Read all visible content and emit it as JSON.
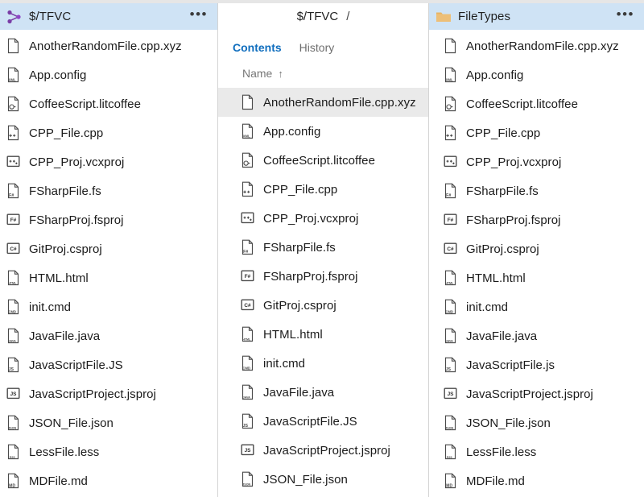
{
  "left_panel": {
    "header": {
      "icon": "tfvc-branch-icon",
      "title": "$/TFVC",
      "overflow_label": "•••"
    },
    "items": [
      {
        "name": "AnotherRandomFile.cpp.xyz",
        "icon": "file-blank-icon",
        "badge": ""
      },
      {
        "name": "App.config",
        "icon": "file-ext-icon",
        "badge": "XML"
      },
      {
        "name": "CoffeeScript.litcoffee",
        "icon": "file-coffee-icon",
        "badge": ""
      },
      {
        "name": "CPP_File.cpp",
        "icon": "file-cpp-icon",
        "badge": ""
      },
      {
        "name": "CPP_Proj.vcxproj",
        "icon": "square-cpp-icon",
        "badge": "++"
      },
      {
        "name": "FSharpFile.fs",
        "icon": "file-fsharp-icon",
        "badge": "F#"
      },
      {
        "name": "FSharpProj.fsproj",
        "icon": "square-badge-icon",
        "badge": "F#"
      },
      {
        "name": "GitProj.csproj",
        "icon": "square-badge-icon",
        "badge": "C#"
      },
      {
        "name": "HTML.html",
        "icon": "file-ext-icon",
        "badge": "HTML"
      },
      {
        "name": "init.cmd",
        "icon": "file-ext-icon",
        "badge": "CMD"
      },
      {
        "name": "JavaFile.java",
        "icon": "file-ext-icon",
        "badge": "JAVA"
      },
      {
        "name": "JavaScriptFile.JS",
        "icon": "file-js-icon",
        "badge": "JS"
      },
      {
        "name": "JavaScriptProject.jsproj",
        "icon": "square-badge-icon",
        "badge": "JS"
      },
      {
        "name": "JSON_File.json",
        "icon": "file-ext-icon",
        "badge": "JSON"
      },
      {
        "name": "LessFile.less",
        "icon": "file-ext-icon",
        "badge": "less"
      },
      {
        "name": "MDFile.md",
        "icon": "file-ext-icon",
        "badge": "MD"
      }
    ]
  },
  "mid_panel": {
    "breadcrumb": {
      "root": "$/TFVC",
      "separator": "/"
    },
    "tabs": [
      {
        "label": "Contents",
        "active": true
      },
      {
        "label": "History",
        "active": false
      }
    ],
    "column_header": {
      "label": "Name",
      "sort_arrow": "↑"
    },
    "items": [
      {
        "name": "AnotherRandomFile.cpp.xyz",
        "icon": "file-blank-icon",
        "badge": "",
        "selected": true
      },
      {
        "name": "App.config",
        "icon": "file-ext-icon",
        "badge": "XML",
        "selected": false
      },
      {
        "name": "CoffeeScript.litcoffee",
        "icon": "file-coffee-icon",
        "badge": "",
        "selected": false
      },
      {
        "name": "CPP_File.cpp",
        "icon": "file-cpp-icon",
        "badge": "",
        "selected": false
      },
      {
        "name": "CPP_Proj.vcxproj",
        "icon": "square-cpp-icon",
        "badge": "++",
        "selected": false
      },
      {
        "name": "FSharpFile.fs",
        "icon": "file-fsharp-icon",
        "badge": "F#",
        "selected": false
      },
      {
        "name": "FSharpProj.fsproj",
        "icon": "square-badge-icon",
        "badge": "F#",
        "selected": false
      },
      {
        "name": "GitProj.csproj",
        "icon": "square-badge-icon",
        "badge": "C#",
        "selected": false
      },
      {
        "name": "HTML.html",
        "icon": "file-ext-icon",
        "badge": "HTML",
        "selected": false
      },
      {
        "name": "init.cmd",
        "icon": "file-ext-icon",
        "badge": "CMD",
        "selected": false
      },
      {
        "name": "JavaFile.java",
        "icon": "file-ext-icon",
        "badge": "JAVA",
        "selected": false
      },
      {
        "name": "JavaScriptFile.JS",
        "icon": "file-js-icon",
        "badge": "JS",
        "selected": false
      },
      {
        "name": "JavaScriptProject.jsproj",
        "icon": "square-badge-icon",
        "badge": "JS",
        "selected": false
      },
      {
        "name": "JSON_File.json",
        "icon": "file-ext-icon",
        "badge": "JSON",
        "selected": false
      }
    ]
  },
  "right_panel": {
    "header": {
      "icon": "folder-icon",
      "title": "FileTypes",
      "overflow_label": "•••"
    },
    "items": [
      {
        "name": "AnotherRandomFile.cpp.xyz",
        "icon": "file-blank-icon",
        "badge": ""
      },
      {
        "name": "App.config",
        "icon": "file-ext-icon",
        "badge": "XML"
      },
      {
        "name": "CoffeeScript.litcoffee",
        "icon": "file-coffee-icon",
        "badge": ""
      },
      {
        "name": "CPP_File.cpp",
        "icon": "file-cpp-icon",
        "badge": ""
      },
      {
        "name": "CPP_Proj.vcxproj",
        "icon": "square-cpp-icon",
        "badge": "++"
      },
      {
        "name": "FSharpFile.fs",
        "icon": "file-fsharp-icon",
        "badge": "F#"
      },
      {
        "name": "FSharpProj.fsproj",
        "icon": "square-badge-icon",
        "badge": "F#"
      },
      {
        "name": "GitProj.csproj",
        "icon": "square-badge-icon",
        "badge": "C#"
      },
      {
        "name": "HTML.html",
        "icon": "file-ext-icon",
        "badge": "HTML"
      },
      {
        "name": "init.cmd",
        "icon": "file-ext-icon",
        "badge": "CMD"
      },
      {
        "name": "JavaFile.java",
        "icon": "file-ext-icon",
        "badge": "JAVA"
      },
      {
        "name": "JavaScriptFile.js",
        "icon": "file-js-icon",
        "badge": "JS"
      },
      {
        "name": "JavaScriptProject.jsproj",
        "icon": "square-badge-icon",
        "badge": "JS"
      },
      {
        "name": "JSON_File.json",
        "icon": "file-ext-icon",
        "badge": "JSON"
      },
      {
        "name": "LessFile.less",
        "icon": "file-ext-icon",
        "badge": "less"
      },
      {
        "name": "MDFile.md",
        "icon": "file-ext-icon",
        "badge": "MD"
      }
    ]
  },
  "colors": {
    "header_bg": "#cfe3f5",
    "selected_row_bg": "#eaeaea",
    "accent_link": "#106ebe",
    "folder_gold": "#e8b464",
    "tfvc_purple": "#7a3da6",
    "text_primary": "#1b1b1b",
    "text_muted": "#767676",
    "divider": "#d4d4d4"
  }
}
